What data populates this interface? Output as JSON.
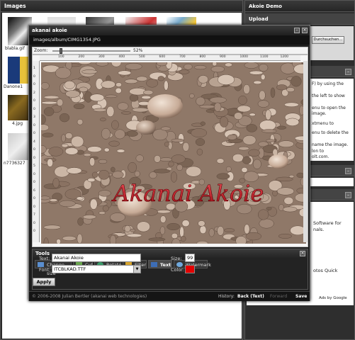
{
  "images_panel": {
    "title": "Images",
    "thumbs": [
      {
        "caption": "blabla.gif"
      },
      {
        "caption": "Danone1"
      },
      {
        "caption": "4.jpg"
      },
      {
        "caption": "n7736327"
      }
    ]
  },
  "right_panel": {
    "title": "Akoie Demo",
    "upload_title": "Upload",
    "browse_label": "Durchsuchen...",
    "help_lines": [
      "F) by using the",
      "the left to show",
      "enu to open the",
      "image.",
      "xtmenu to",
      "enu to delete the",
      "name the image.",
      "lon to",
      "olt.com."
    ],
    "ad_lines": [
      "Software for",
      "nals.",
      "otos Quick"
    ],
    "ads_by": "Ads by Google"
  },
  "editor": {
    "title": "akanai akoie",
    "path": "images/album/CIMG1354.JPG",
    "zoom_label": "Zoom:",
    "zoom_value": "52%",
    "ruler_marks": [
      "100",
      "200",
      "300",
      "400",
      "500",
      "600",
      "700",
      "800",
      "900",
      "1000",
      "1100",
      "1200"
    ],
    "vruler_marks": [
      "1",
      "0",
      "0",
      "2",
      "0",
      "0",
      "3",
      "0",
      "0",
      "4",
      "0",
      "0",
      "5",
      "0",
      "0",
      "6",
      "0",
      "0",
      "7",
      "0",
      "0"
    ],
    "overlay_text": "Akanai Akoie",
    "colors": {
      "overlay": "#c8121e",
      "color_swatch": "#e30000"
    },
    "tools": {
      "title": "Tools",
      "tabs": [
        "Change size",
        "Cut",
        "Rotate",
        "Filter",
        "Text",
        "Watermark"
      ],
      "active_tab": "Text",
      "text_label": "Text:",
      "text_value": "Akanai Akoie",
      "font_label": "Font:",
      "font_value": "ITCBLKAD.TTF",
      "size_label": "Size:",
      "size_value": "99",
      "color_label": "Color:",
      "apply_label": "Apply"
    },
    "footer": {
      "copyright": "© 2006-2008 Julian Bertler (akanai web technologies)",
      "history_label": "History:",
      "back_label": "Back (Text)",
      "forward_label": "Forward",
      "save_label": "Save"
    }
  }
}
